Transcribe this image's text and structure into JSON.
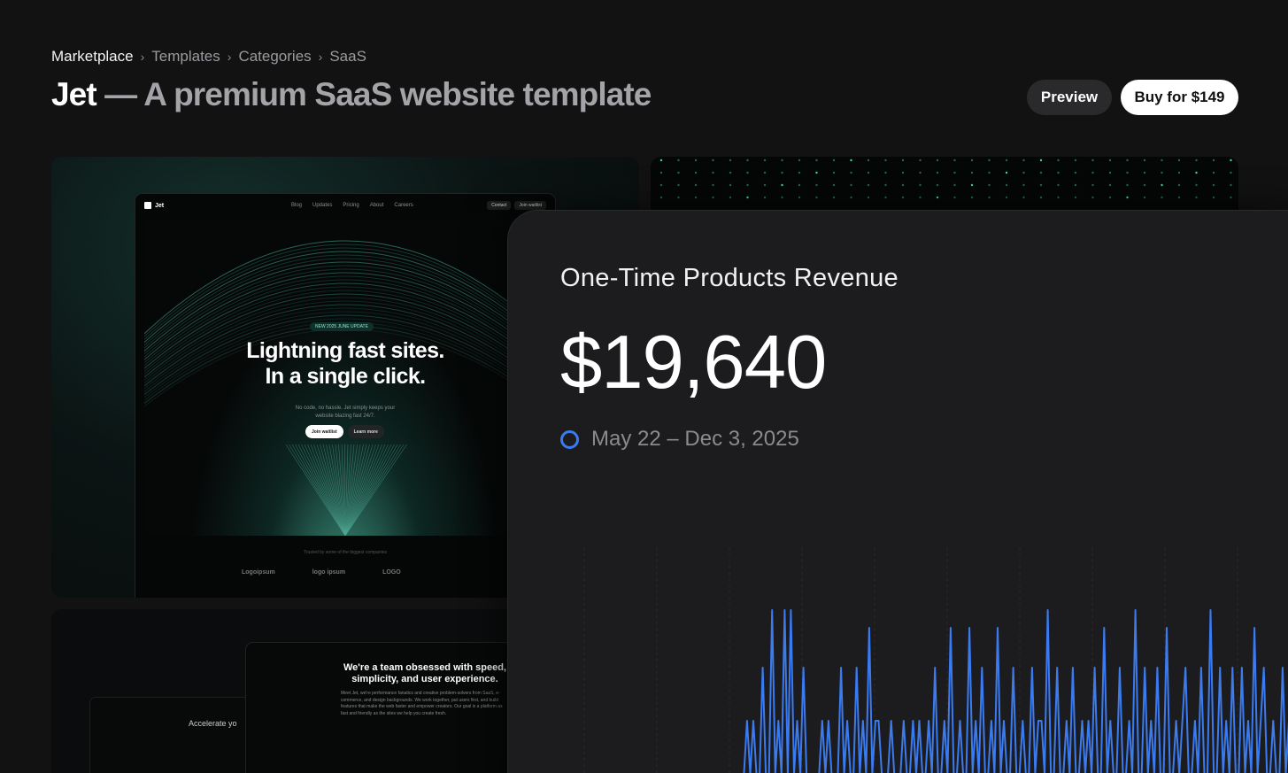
{
  "breadcrumb": [
    "Marketplace",
    "Templates",
    "Categories",
    "SaaS"
  ],
  "header": {
    "name": "Jet",
    "tagline": " — A premium SaaS website template",
    "preview_label": "Preview",
    "buy_label": "Buy for $149"
  },
  "template_preview": {
    "nav": {
      "logo": "Jet",
      "links": [
        "Blog",
        "Updates",
        "Pricing",
        "About",
        "Careers"
      ],
      "contact": "Contact",
      "join": "Join waitlist"
    },
    "pill": "NEW 2025 JUNE UPDATE",
    "headline_1": "Lightning fast sites.",
    "headline_2": "In a single click.",
    "subtext": "No code, no hassle. Jet simply keeps your website blazing fast 24/7.",
    "btn_primary": "Join waitlist",
    "btn_secondary": "Learn more",
    "trusted": "Trusted by some of the biggest companies",
    "logos": [
      "Logoipsum",
      "logo ipsum",
      "LOGO"
    ]
  },
  "about_preview": {
    "headline": "We're a team obsessed with speed, simplicity, and user experience.",
    "paragraph": "Meet Jet, we're performance fanatics and creative problem-solvers from SaaS, e-commerce, and design backgrounds. We work together, put users first, and build features that make the web faster and empower creators. Our goal is a platform as fast and friendly as the sites we help you create fresh.",
    "accelerate": "Accelerate yo"
  },
  "revenue_card": {
    "title": "One-Time Products Revenue",
    "value": "$19,640",
    "date_range": "May 22 – Dec 3, 2025",
    "accent": "#3b7bf0"
  },
  "chart_data": {
    "type": "line",
    "series": [
      {
        "values": [
          0,
          0,
          0,
          0,
          0,
          0,
          0,
          0,
          0,
          0,
          0,
          0,
          0,
          0,
          0,
          0,
          0,
          0,
          0,
          0,
          0,
          0,
          0,
          0,
          0,
          0,
          0,
          0,
          0,
          0,
          0,
          0,
          0,
          0,
          0,
          0,
          0,
          0,
          0,
          0,
          0,
          0,
          0,
          0,
          0,
          0,
          0,
          0,
          0,
          0,
          0,
          0,
          0,
          0,
          0,
          0,
          0,
          0,
          0,
          0,
          0,
          0,
          0,
          0,
          0,
          0,
          0,
          0,
          0,
          0,
          0,
          0,
          0,
          0,
          0,
          0,
          0,
          0,
          0,
          0,
          0,
          0,
          0,
          0,
          0,
          0,
          0,
          0,
          0,
          0,
          0,
          0,
          0,
          0,
          0,
          0,
          0,
          0,
          0,
          0,
          0,
          0,
          0,
          0,
          0,
          0,
          0,
          0,
          0,
          0,
          0,
          0,
          0,
          0,
          0,
          0,
          0,
          0,
          0,
          0,
          0,
          0,
          0,
          0,
          0,
          0,
          0,
          0,
          0,
          0,
          0,
          0,
          0,
          0,
          0,
          0,
          0,
          0,
          0,
          0,
          0,
          0,
          0,
          0,
          0,
          0,
          0,
          0,
          0,
          0,
          0,
          0,
          0,
          0,
          0,
          0,
          0,
          0,
          0,
          0,
          0,
          0,
          0,
          0,
          0,
          0,
          0,
          0,
          0,
          0,
          0,
          0,
          0,
          0,
          0,
          0,
          0,
          0,
          0,
          0,
          0,
          0,
          0,
          0,
          0,
          0,
          0,
          0,
          0,
          0,
          0,
          0,
          0,
          0,
          0,
          0,
          0,
          0,
          0,
          0
        ]
      }
    ],
    "peaks": [
      0,
      0,
      0,
      0,
      0,
      0,
      0,
      0,
      0,
      0,
      0,
      0,
      0,
      0,
      0,
      0,
      0,
      0,
      0,
      0,
      0,
      0,
      0,
      0,
      1,
      0,
      1,
      0,
      0,
      2,
      0,
      0,
      4,
      0,
      1,
      0,
      4,
      0,
      4,
      0,
      1,
      0,
      2,
      0,
      0,
      0,
      0,
      0,
      1,
      0,
      1,
      0,
      0,
      0,
      2,
      0,
      1,
      0,
      0,
      2,
      0,
      1,
      0,
      3,
      0,
      1,
      1,
      0,
      0,
      0,
      1,
      0,
      0,
      0,
      1,
      0,
      0,
      1,
      0,
      1,
      0,
      0,
      1,
      0,
      2,
      0,
      0,
      1,
      0,
      3,
      0,
      0,
      1,
      0,
      0,
      3,
      0,
      1,
      0,
      2,
      0,
      0,
      1,
      0,
      3,
      0,
      1,
      0,
      0,
      2,
      0,
      0,
      1,
      0,
      0,
      2,
      0,
      1,
      1,
      0,
      4,
      0,
      0,
      2,
      0,
      0,
      1,
      0,
      2,
      0,
      0,
      1,
      0,
      1,
      0,
      2,
      0,
      0,
      3,
      0,
      1,
      0,
      0,
      2,
      0,
      0,
      1,
      0,
      4,
      0,
      0,
      2,
      0,
      1,
      0,
      2,
      0,
      0,
      3,
      0,
      0,
      1,
      0,
      1,
      2,
      0,
      0,
      1,
      0,
      2,
      0,
      0,
      4,
      0,
      0,
      2,
      0,
      1,
      0,
      2,
      0,
      0,
      2,
      0,
      1,
      0,
      3,
      0,
      1,
      2,
      0,
      0,
      1,
      0,
      0,
      2,
      0,
      1
    ],
    "peak_levels": [
      0,
      60,
      120,
      165,
      185,
      245
    ],
    "y_max": 245
  }
}
